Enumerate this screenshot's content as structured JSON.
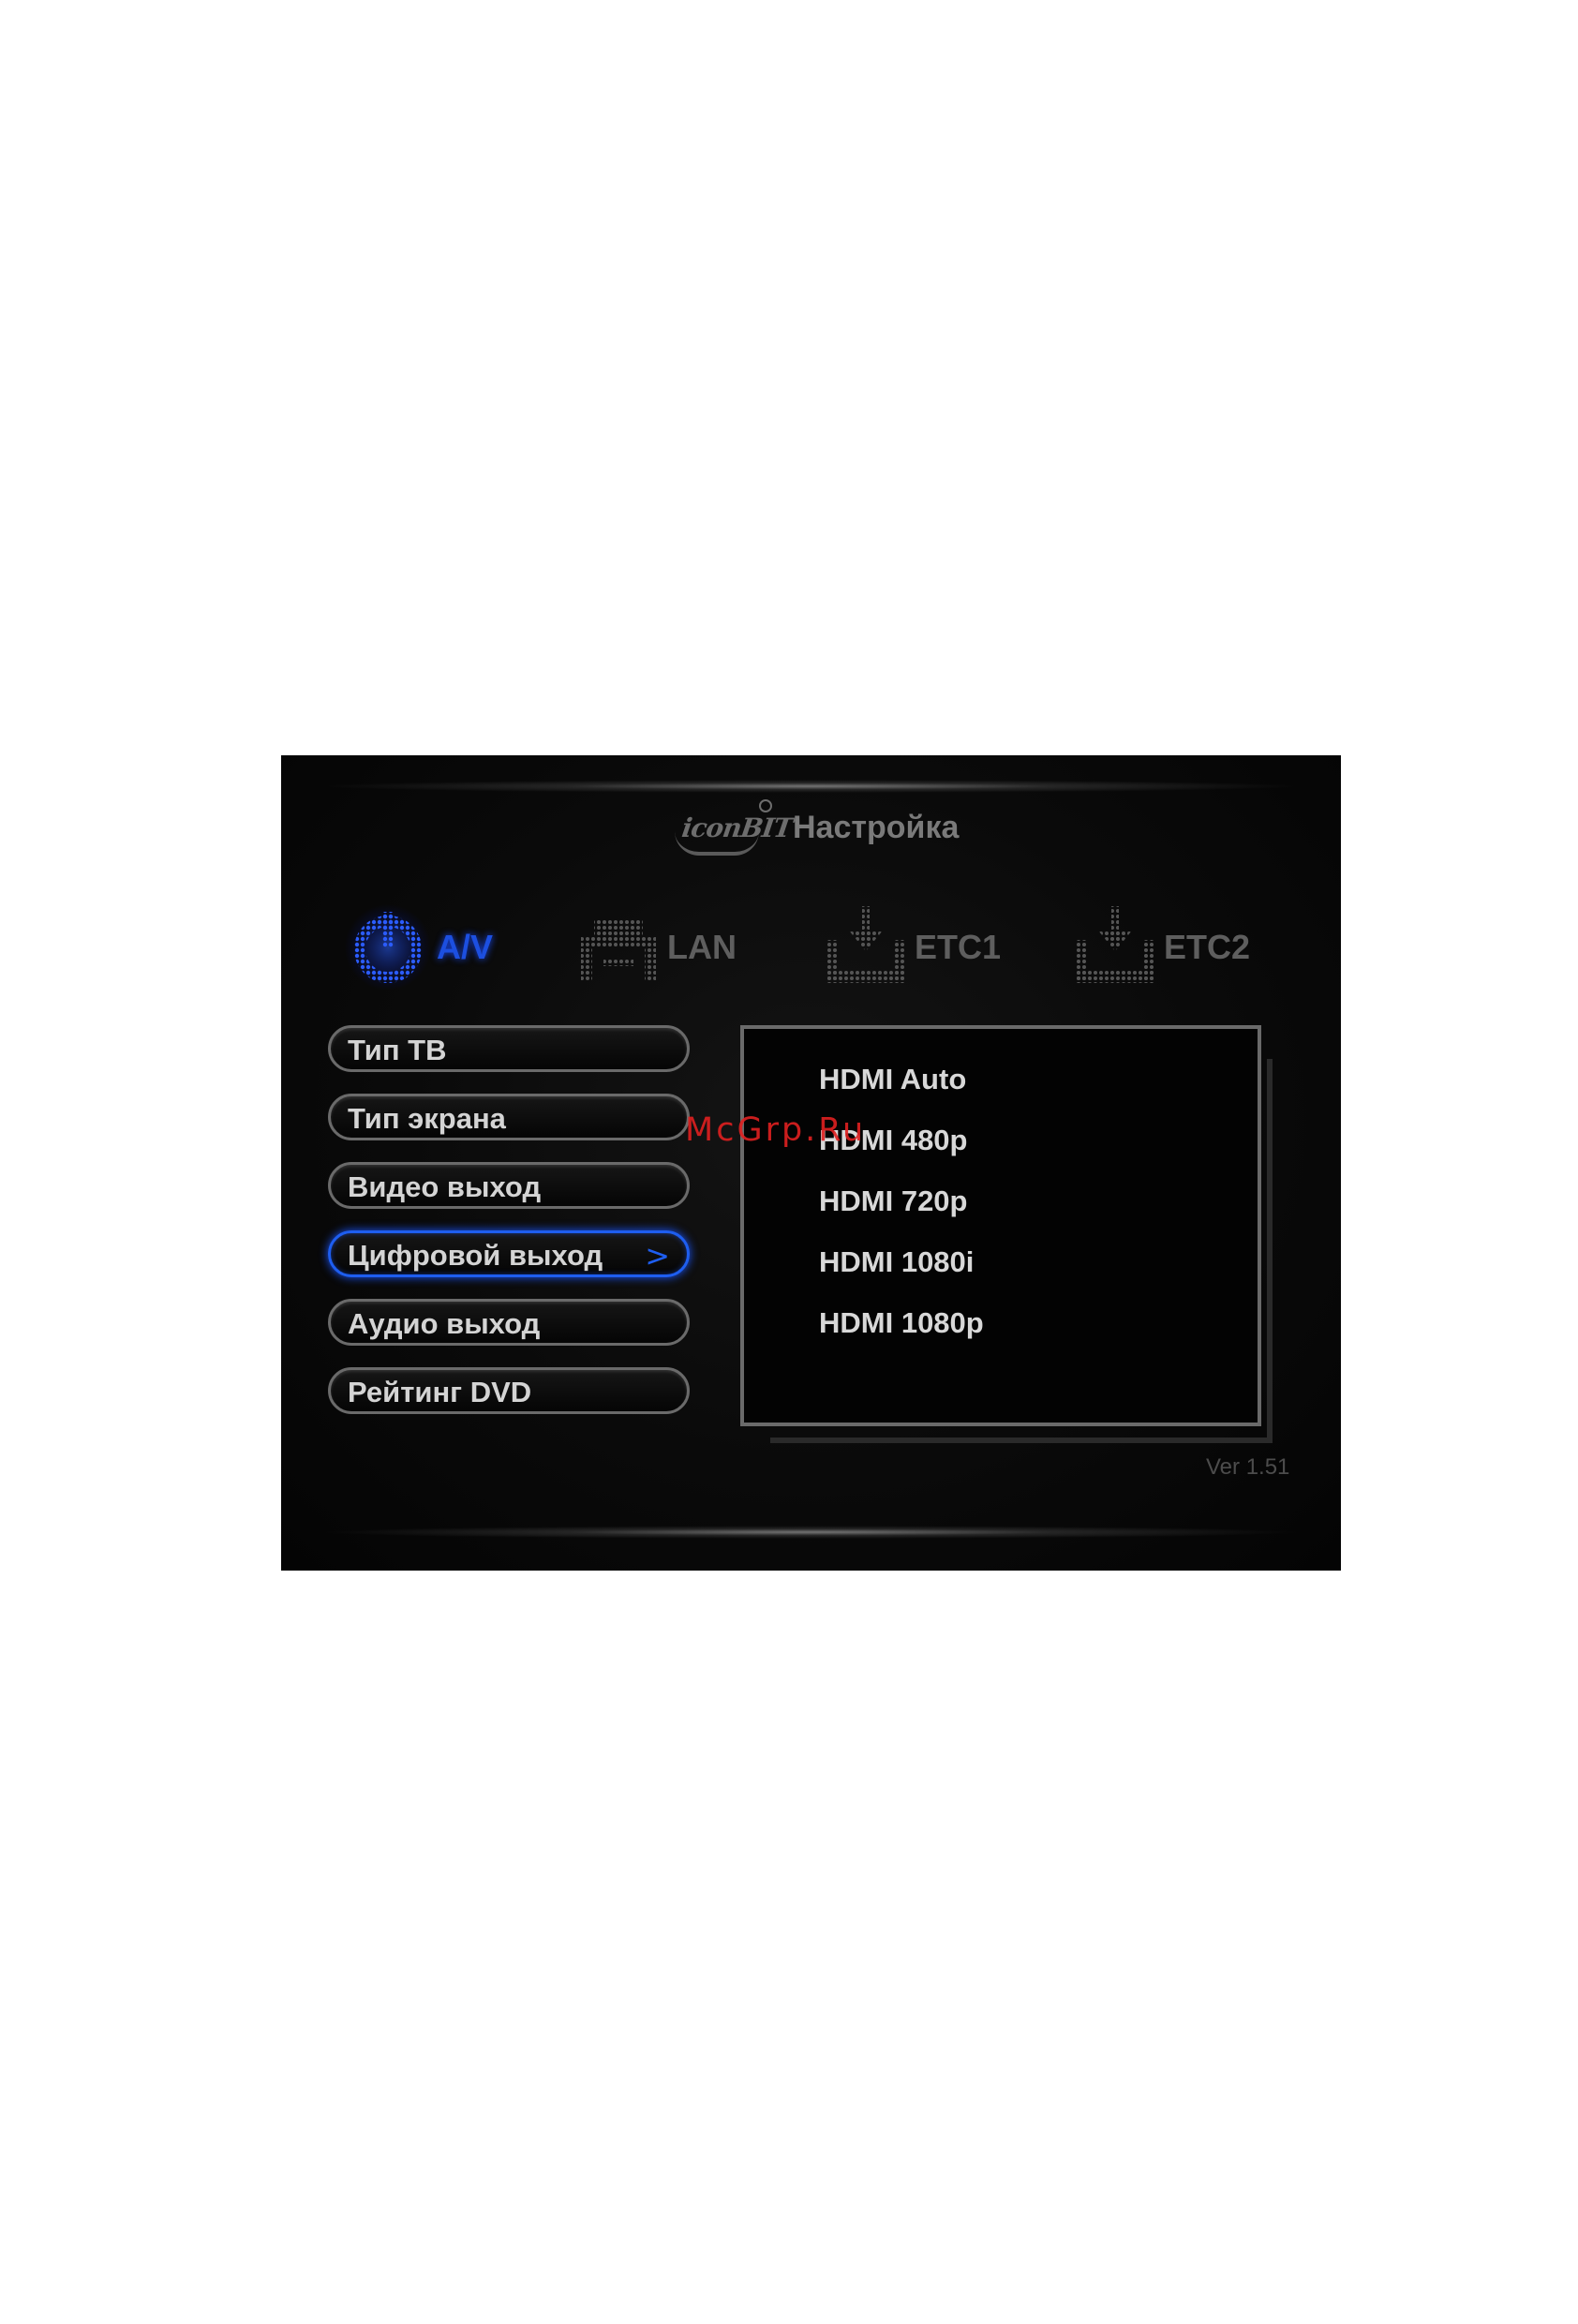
{
  "header": {
    "logo_text": "iconBIT",
    "title": "Настройка"
  },
  "tabs": [
    {
      "label": "A/V",
      "icon": "power-dot-icon",
      "active": true,
      "color": "#1c4fe0"
    },
    {
      "label": "LAN",
      "icon": "network-dot-icon",
      "active": false
    },
    {
      "label": "ETC1",
      "icon": "download-dot-icon",
      "active": false
    },
    {
      "label": "ETC2",
      "icon": "download-dot-icon",
      "active": false
    }
  ],
  "menu": {
    "items": [
      {
        "label": "Тип ТВ"
      },
      {
        "label": "Тип экрана"
      },
      {
        "label": "Видео выход"
      },
      {
        "label": "Цифровой выход",
        "selected": true
      },
      {
        "label": "Аудио выход"
      },
      {
        "label": "Рейтинг DVD"
      }
    ],
    "arrow": ">"
  },
  "options": [
    "HDMI Auto",
    "HDMI 480p",
    "HDMI 720p",
    "HDMI 1080i",
    "HDMI 1080p"
  ],
  "version": "Ver 1.51",
  "watermark": "McGrp.Ru",
  "colors": {
    "accent": "#1e5ef0",
    "background": "#0a0a0a",
    "text": "#d4d4d4",
    "watermark": "#e02020"
  }
}
